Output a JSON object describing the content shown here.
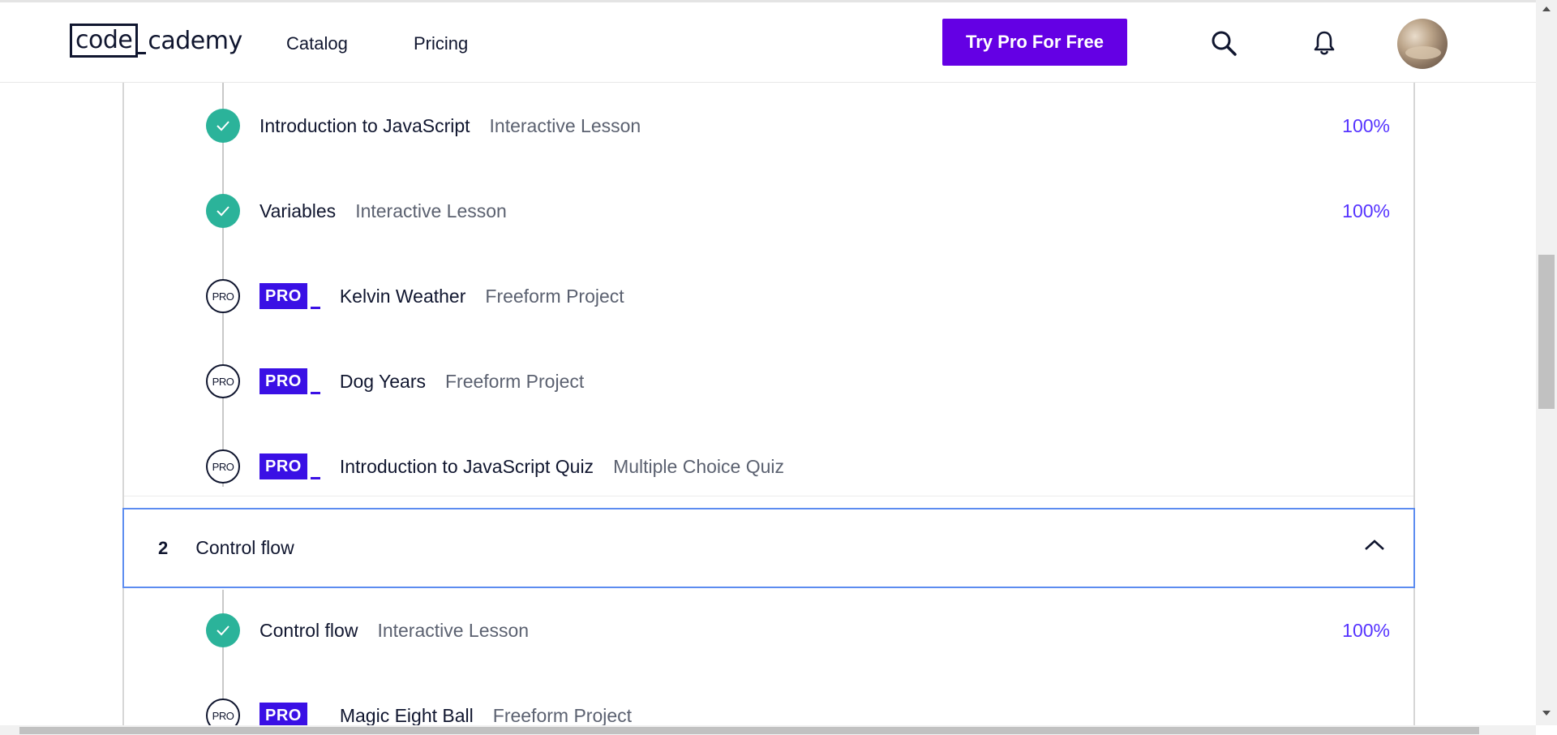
{
  "header": {
    "logo_part1": "code",
    "logo_part2": "cademy",
    "nav": [
      "Catalog",
      "Pricing"
    ],
    "cta_label": "Try Pro For Free",
    "icons": [
      "search-icon",
      "bell-icon"
    ]
  },
  "colors": {
    "cta": "#6400e4",
    "complete": "#2bb39a",
    "pro_badge": "#3a10e5",
    "percent": "#5533ff",
    "focus_border": "#5c8cf0"
  },
  "section1": {
    "items": [
      {
        "title": "Introduction to JavaScript",
        "kind": "Interactive Lesson",
        "status": "complete",
        "percent": "100%"
      },
      {
        "title": "Variables",
        "kind": "Interactive Lesson",
        "status": "complete",
        "percent": "100%"
      },
      {
        "status_label": "PRO",
        "badge": "PRO",
        "title": "Kelvin Weather",
        "kind": "Freeform Project",
        "status": "pro"
      },
      {
        "status_label": "PRO",
        "badge": "PRO",
        "title": "Dog Years",
        "kind": "Freeform Project",
        "status": "pro"
      },
      {
        "status_label": "PRO",
        "badge": "PRO",
        "title": "Introduction to JavaScript Quiz",
        "kind": "Multiple Choice Quiz",
        "status": "pro"
      }
    ]
  },
  "section2": {
    "number": "2",
    "title": "Control flow",
    "expanded": true,
    "items": [
      {
        "title": "Control flow",
        "kind": "Interactive Lesson",
        "status": "complete",
        "percent": "100%"
      },
      {
        "status_label": "PRO",
        "badge": "PRO",
        "title": "Magic Eight Ball",
        "kind": "Freeform Project",
        "status": "pro"
      }
    ]
  }
}
